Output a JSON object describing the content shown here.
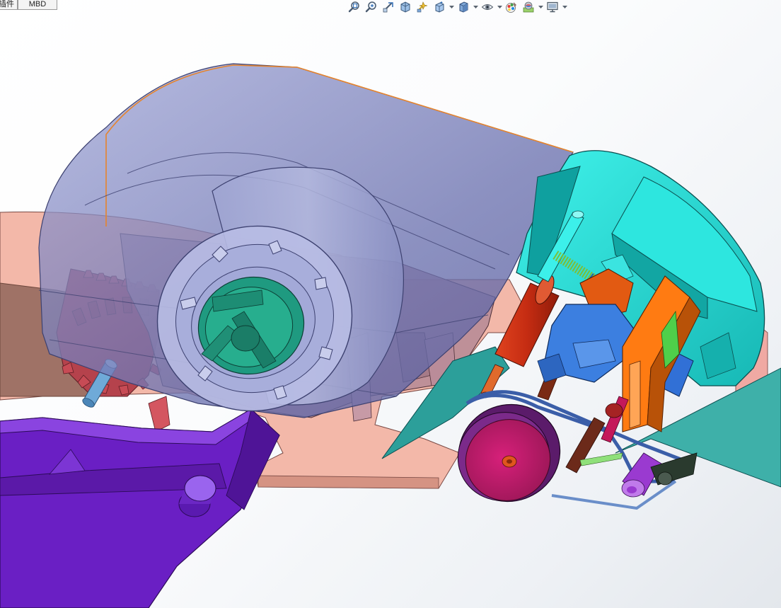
{
  "tabs": [
    {
      "label": "插件"
    },
    {
      "label": "MBD"
    }
  ],
  "heads_up_toolbar": {
    "tools": [
      {
        "icon": "zoom-to-fit-icon"
      },
      {
        "icon": "zoom-to-area-icon"
      },
      {
        "icon": "previous-view-icon"
      },
      {
        "icon": "section-view-icon"
      },
      {
        "icon": "dynamic-annotation-views-icon"
      },
      {
        "icon": "view-orientation-icon"
      },
      {
        "icon": "display-style-icon"
      },
      {
        "icon": "hide-show-items-icon"
      },
      {
        "icon": "edit-appearance-icon"
      },
      {
        "icon": "apply-scene-icon"
      },
      {
        "icon": "view-settings-icon"
      }
    ]
  }
}
